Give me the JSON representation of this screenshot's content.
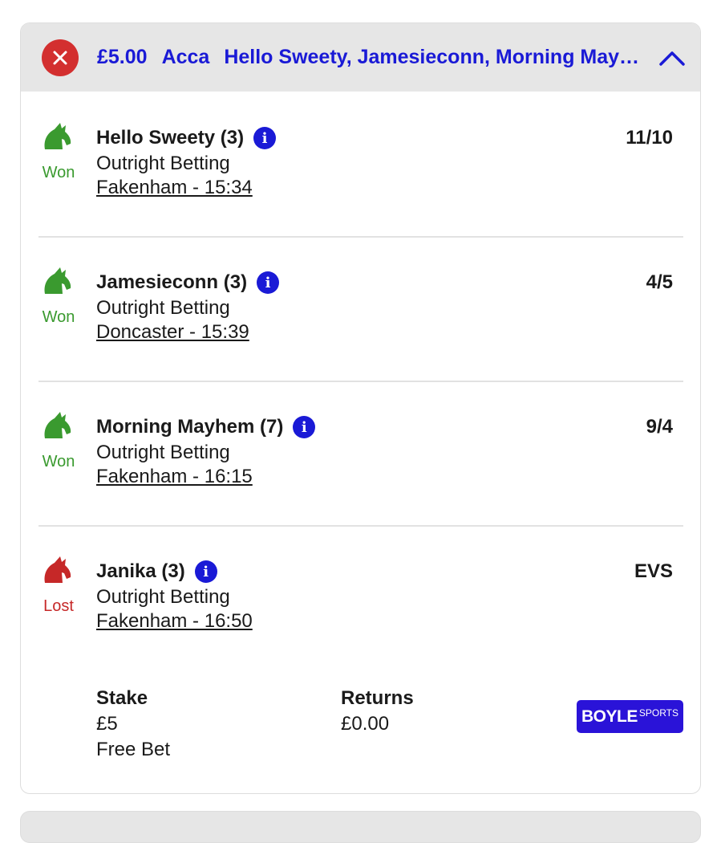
{
  "header": {
    "stake": "£5.00",
    "bet_type": "Acca",
    "selections_summary": "Hello Sweety, Jamesieconn, Morning May…",
    "close_icon": "close-icon",
    "collapse_icon": "chevron-up-icon",
    "close_color": "#d32f2f",
    "accent_color": "#1a1ad6"
  },
  "selections": [
    {
      "name": "Hello Sweety (3)",
      "market": "Outright Betting",
      "event": "Fakenham - 15:34",
      "odds": "11/10",
      "result": "Won",
      "icon": "horse-head-icon"
    },
    {
      "name": "Jamesieconn (3)",
      "market": "Outright Betting",
      "event": "Doncaster - 15:39",
      "odds": "4/5",
      "result": "Won",
      "icon": "horse-head-icon"
    },
    {
      "name": "Morning Mayhem (7)",
      "market": "Outright Betting",
      "event": "Fakenham - 16:15",
      "odds": "9/4",
      "result": "Won",
      "icon": "horse-head-icon"
    },
    {
      "name": "Janika (3)",
      "market": "Outright Betting",
      "event": "Fakenham - 16:50",
      "odds": "EVS",
      "result": "Lost",
      "icon": "horse-head-icon"
    }
  ],
  "info_glyph": "i",
  "footer": {
    "stake_label": "Stake",
    "stake_value": "£5",
    "stake_note": "Free Bet",
    "returns_label": "Returns",
    "returns_value": "£0.00",
    "brand_main": "BOYLE",
    "brand_sub": "SPORTS"
  },
  "colors": {
    "won": "#3a9a2f",
    "lost": "#c62828",
    "brand": "#2a13d8"
  }
}
